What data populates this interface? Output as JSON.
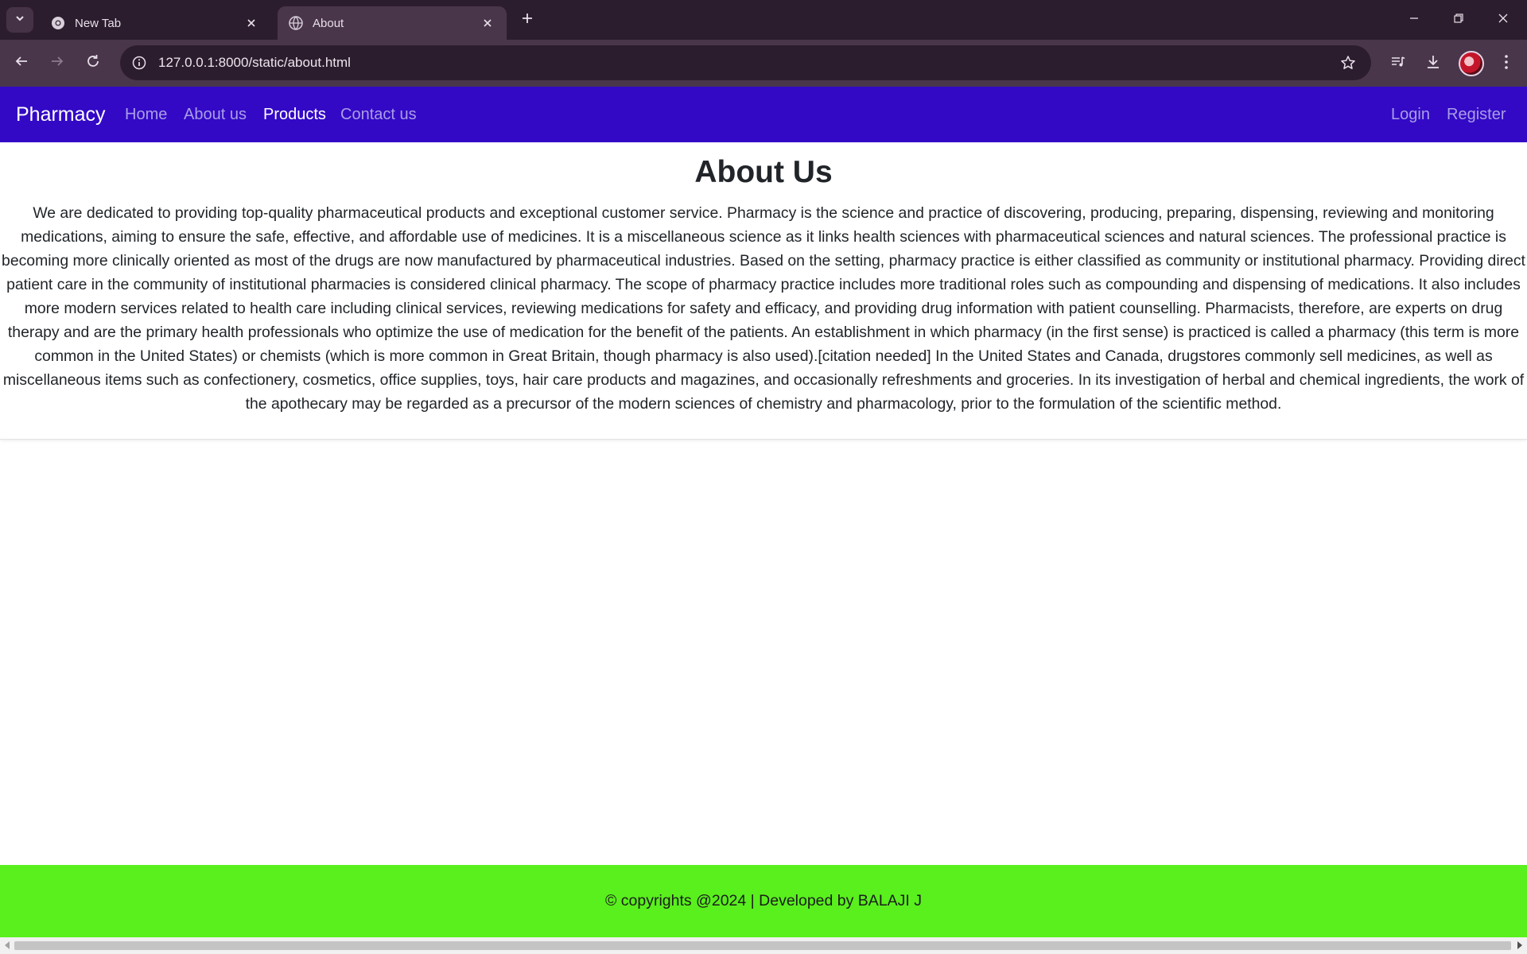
{
  "browser": {
    "tabs": [
      {
        "title": "New Tab",
        "active": false
      },
      {
        "title": "About",
        "active": true
      }
    ],
    "url": "127.0.0.1:8000/static/about.html",
    "icons": {
      "tab_search": "chevron-down-icon",
      "new_tab": "plus-icon",
      "minimize": "minimize-icon",
      "restore": "restore-icon",
      "close": "close-icon",
      "back": "back-arrow-icon",
      "forward": "forward-arrow-icon",
      "reload": "reload-icon",
      "site_info": "info-icon",
      "bookmark": "star-icon",
      "media": "media-queue-icon",
      "downloads": "download-icon",
      "menu": "kebab-menu-icon"
    },
    "colors": {
      "frame": "#2c1d2e",
      "toolbar": "#4a364b"
    }
  },
  "navbar": {
    "brand": "Pharmacy",
    "links": [
      "Home",
      "About us",
      "Products",
      "Contact us"
    ],
    "active_link": "Products",
    "right_links": [
      "Login",
      "Register"
    ],
    "colors": {
      "background": "#3309c6",
      "link": "#a99ee6",
      "active": "#ffffff"
    }
  },
  "main": {
    "heading": "About Us",
    "body": "We are dedicated to providing top-quality pharmaceutical products and exceptional customer service. Pharmacy is the science and practice of discovering, producing, preparing, dispensing, reviewing and monitoring medications, aiming to ensure the safe, effective, and affordable use of medicines. It is a miscellaneous science as it links health sciences with pharmaceutical sciences and natural sciences. The professional practice is becoming more clinically oriented as most of the drugs are now manufactured by pharmaceutical industries. Based on the setting, pharmacy practice is either classified as community or institutional pharmacy. Providing direct patient care in the community of institutional pharmacies is considered clinical pharmacy. The scope of pharmacy practice includes more traditional roles such as compounding and dispensing of medications. It also includes more modern services related to health care including clinical services, reviewing medications for safety and efficacy, and providing drug information with patient counselling. Pharmacists, therefore, are experts on drug therapy and are the primary health professionals who optimize the use of medication for the benefit of the patients. An establishment in which pharmacy (in the first sense) is practiced is called a pharmacy (this term is more common in the United States) or chemists (which is more common in Great Britain, though pharmacy is also used).[citation needed] In the United States and Canada, drugstores commonly sell medicines, as well as miscellaneous items such as confectionery, cosmetics, office supplies, toys, hair care products and magazines, and occasionally refreshments and groceries. In its investigation of herbal and chemical ingredients, the work of the apothecary may be regarded as a precursor of the modern sciences of chemistry and pharmacology, prior to the formulation of the scientific method."
  },
  "footer": {
    "text": "© copyrights @2024 | Developed by BALAJI J",
    "color": "#59f01d"
  }
}
